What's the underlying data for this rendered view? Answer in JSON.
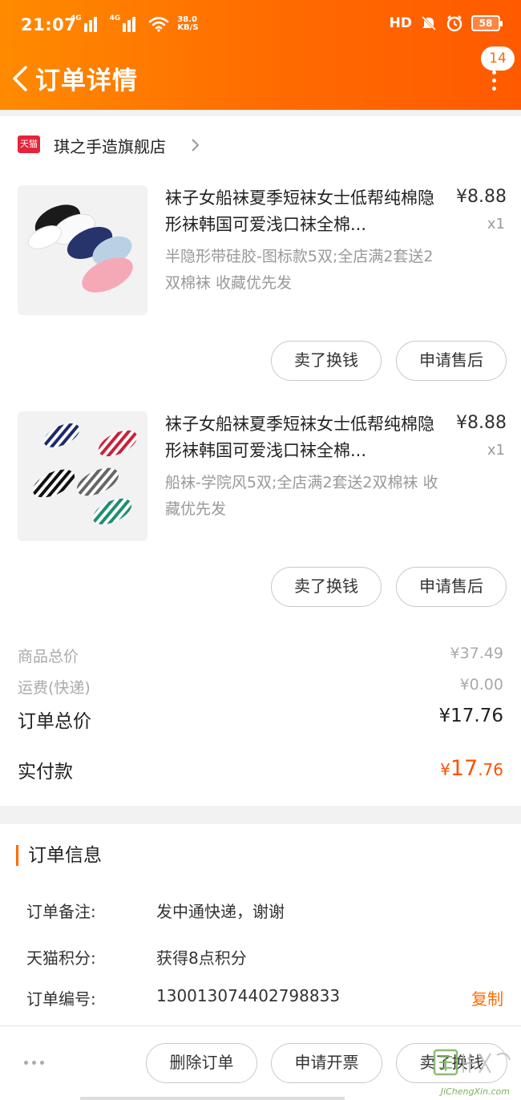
{
  "status_bar": {
    "time": "21:07",
    "net_label": "4G",
    "speed": "38.0",
    "speed_unit": "KB/S",
    "hd": "HD",
    "battery": "58"
  },
  "nav": {
    "title": "订单详情",
    "badge": "14"
  },
  "shop": {
    "badge": "天猫",
    "name": "琪之手造旗舰店"
  },
  "items": [
    {
      "title": "袜子女船袜夏季短袜女士低帮纯棉隐形袜韩国可爱浅口袜全棉...",
      "spec": "半隐形带硅胶-图标款5双;全店满2套送2双棉袜 收藏优先发",
      "price": "¥8.88",
      "qty": "x1",
      "btn_sell": "卖了换钱",
      "btn_after": "申请售后"
    },
    {
      "title": "袜子女船袜夏季短袜女士低帮纯棉隐形袜韩国可爱浅口袜全棉...",
      "spec": "船袜-学院风5双;全店满2套送2双棉袜 收藏优先发",
      "price": "¥8.88",
      "qty": "x1",
      "btn_sell": "卖了换钱",
      "btn_after": "申请售后"
    }
  ],
  "summary": {
    "goods_label": "商品总价",
    "goods_value": "¥37.49",
    "shipping_label": "运费(快递)",
    "shipping_value": "¥0.00",
    "total_label": "订单总价",
    "total_value": "¥17.76",
    "paid_label": "实付款",
    "paid_symbol": "¥",
    "paid_int": "17",
    "paid_dec": ".76"
  },
  "order_info": {
    "heading": "订单信息",
    "remark_label": "订单备注:",
    "remark_value": "发中通快递，谢谢",
    "points_label": "天猫积分:",
    "points_value": "获得8点积分",
    "number_label": "订单编号:",
    "number_value": "130013074402798833",
    "copy_label": "复制"
  },
  "bottom_bar": {
    "delete": "删除订单",
    "invoice": "申请开票",
    "sell": "卖了换钱"
  },
  "watermark": {
    "text": "JiChengXin.com"
  },
  "colors": {
    "accent": "#ff6a00",
    "price_red": "#ff5000",
    "tmall_red": "#e5243b"
  },
  "icons": [
    "back-arrow-icon",
    "more-dots-icon",
    "wifi-icon",
    "signal-icon",
    "battery-icon",
    "chevron-right-icon",
    "tmall-badge-icon",
    "more-options-icon"
  ]
}
